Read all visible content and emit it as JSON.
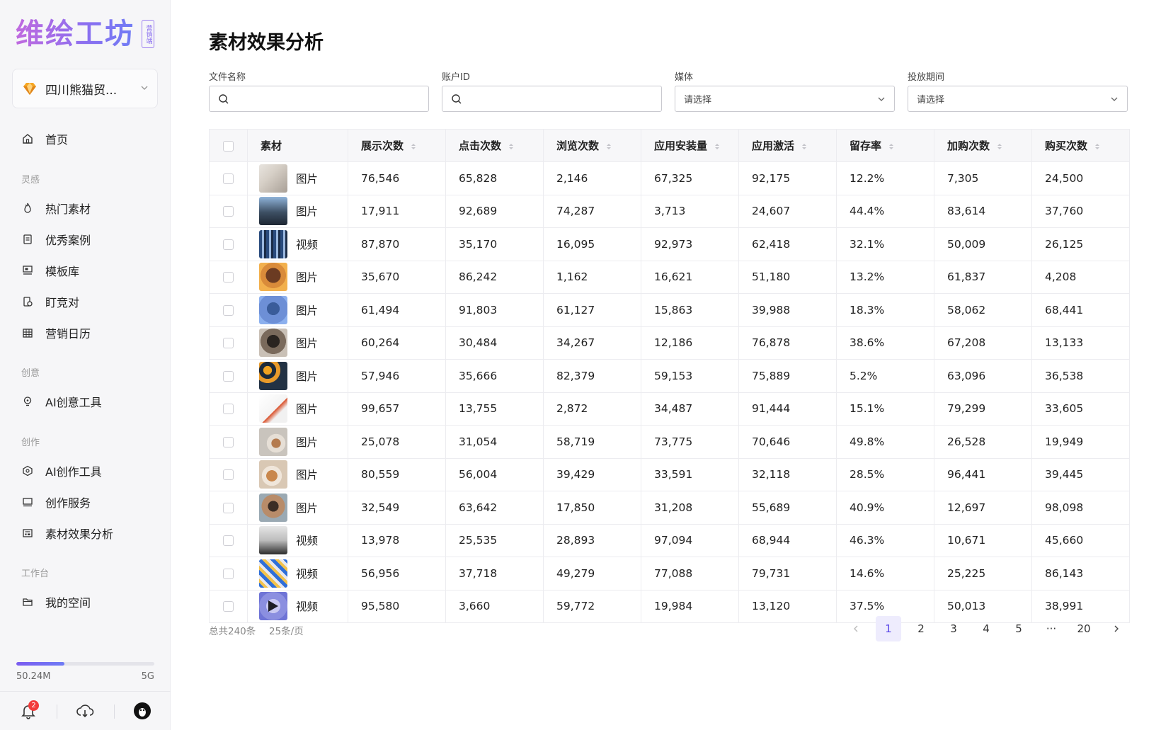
{
  "brand": {
    "name": "维绘工坊",
    "tag": "营销端"
  },
  "account": {
    "name": "四川熊猫贸..."
  },
  "nav": {
    "home": "首页",
    "sections": {
      "inspiration": "灵感",
      "creative": "创意",
      "creation": "创作",
      "workspace": "工作台"
    },
    "items": {
      "hot": "热门素材",
      "cases": "优秀案例",
      "templates": "模板库",
      "competitor": "盯竞对",
      "calendar": "营销日历",
      "ai_creative": "AI创意工具",
      "ai_creation": "AI创作工具",
      "service": "创作服务",
      "analysis": "素材效果分析",
      "myspace": "我的空间"
    }
  },
  "storage": {
    "used": "50.24M",
    "total": "5G",
    "fraction": 0.35
  },
  "notifications": {
    "count": "2"
  },
  "page": {
    "title": "素材效果分析"
  },
  "filters": {
    "file_name": {
      "label": "文件名称",
      "value": ""
    },
    "account_id": {
      "label": "账户ID",
      "value": ""
    },
    "media": {
      "label": "媒体",
      "placeholder": "请选择"
    },
    "period": {
      "label": "投放期间",
      "placeholder": "请选择"
    }
  },
  "table": {
    "columns": [
      "素材",
      "展示次数",
      "点击次数",
      "浏览次数",
      "应用安装量",
      "应用激活",
      "留存率",
      "加购次数",
      "购买次数"
    ],
    "rows": [
      {
        "type": "图片",
        "cells": [
          "76,546",
          "65,828",
          "2,146",
          "67,325",
          "92,175",
          "12.2%",
          "7,305",
          "24,500"
        ]
      },
      {
        "type": "图片",
        "cells": [
          "17,911",
          "92,689",
          "74,287",
          "3,713",
          "24,607",
          "44.4%",
          "83,614",
          "37,760"
        ]
      },
      {
        "type": "视频",
        "cells": [
          "87,870",
          "35,170",
          "16,095",
          "92,973",
          "62,418",
          "32.1%",
          "50,009",
          "26,125"
        ]
      },
      {
        "type": "图片",
        "cells": [
          "35,670",
          "86,242",
          "1,162",
          "16,621",
          "51,180",
          "13.2%",
          "61,837",
          "4,208"
        ]
      },
      {
        "type": "图片",
        "cells": [
          "61,494",
          "91,803",
          "61,127",
          "15,863",
          "39,988",
          "18.3%",
          "58,062",
          "68,441"
        ]
      },
      {
        "type": "图片",
        "cells": [
          "60,264",
          "30,484",
          "34,267",
          "12,186",
          "76,878",
          "38.6%",
          "67,208",
          "13,133"
        ]
      },
      {
        "type": "图片",
        "cells": [
          "57,946",
          "35,666",
          "82,379",
          "59,153",
          "75,889",
          "5.2%",
          "63,096",
          "36,538"
        ]
      },
      {
        "type": "图片",
        "cells": [
          "99,657",
          "13,755",
          "2,872",
          "34,487",
          "91,444",
          "15.1%",
          "79,299",
          "33,605"
        ]
      },
      {
        "type": "图片",
        "cells": [
          "25,078",
          "31,054",
          "58,719",
          "73,775",
          "70,646",
          "49.8%",
          "26,528",
          "19,949"
        ]
      },
      {
        "type": "图片",
        "cells": [
          "80,559",
          "56,004",
          "39,429",
          "33,591",
          "32,118",
          "28.5%",
          "96,441",
          "39,445"
        ]
      },
      {
        "type": "图片",
        "cells": [
          "32,549",
          "63,642",
          "17,850",
          "31,208",
          "55,689",
          "40.9%",
          "12,697",
          "98,098"
        ]
      },
      {
        "type": "视频",
        "cells": [
          "13,978",
          "25,535",
          "28,893",
          "97,094",
          "68,944",
          "46.3%",
          "10,671",
          "45,660"
        ]
      },
      {
        "type": "视频",
        "cells": [
          "56,956",
          "37,718",
          "49,279",
          "77,088",
          "79,731",
          "14.6%",
          "25,225",
          "86,143"
        ]
      },
      {
        "type": "视频",
        "cells": [
          "95,580",
          "3,660",
          "59,772",
          "19,984",
          "13,120",
          "37.5%",
          "50,013",
          "38,991"
        ]
      }
    ]
  },
  "pagination": {
    "total": "总共240条",
    "per_page": "25条/页",
    "pages": [
      "1",
      "2",
      "3",
      "4",
      "5",
      "···",
      "20"
    ],
    "current": "1"
  },
  "colors": {
    "accent": "#5b48e8",
    "accent_bg": "#eeecfd",
    "sidebar_bg": "#f6f6f8",
    "badge": "#f23b3b"
  }
}
